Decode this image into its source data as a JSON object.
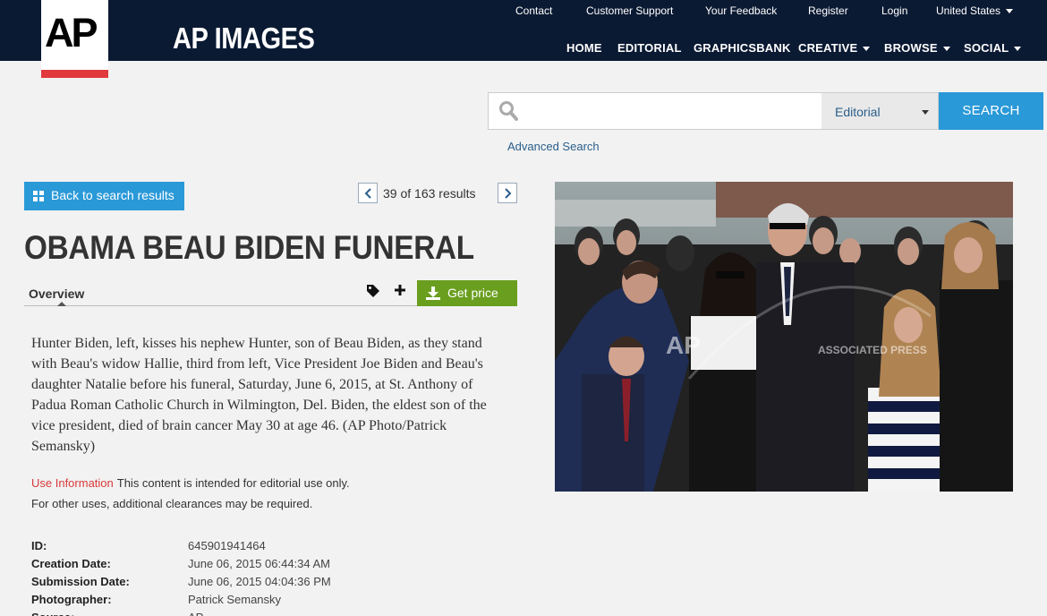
{
  "brand": {
    "logo_text": "AP",
    "name": "AP IMAGES"
  },
  "top_links": [
    "Contact",
    "Customer Support",
    "Your Feedback",
    "Register",
    "Login",
    "United States"
  ],
  "main_nav": [
    "HOME",
    "EDITORIAL",
    "GRAPHICSBANK",
    "CREATIVE",
    "BROWSE",
    "SOCIAL"
  ],
  "search": {
    "value": "",
    "placeholder": "",
    "scope": "Editorial",
    "button": "SEARCH",
    "advanced": "Advanced Search"
  },
  "back_button": "Back to search results",
  "pager": {
    "text": "39  of  163 results"
  },
  "title": "OBAMA BEAU BIDEN FUNERAL",
  "tabs": {
    "overview": "Overview"
  },
  "get_price": "Get price",
  "caption": "Hunter Biden, left, kisses his nephew Hunter, son of Beau Biden, as they stand with Beau's widow Hallie, third from left, Vice President Joe Biden and Beau's daughter Natalie before his funeral, Saturday, June 6, 2015, at St. Anthony of Padua Roman Catholic Church in Wilmington, Del. Biden, the eldest son of the vice president, died of brain cancer May 30 at age 46. (AP Photo/Patrick Semansky)",
  "use_info": {
    "label": "Use Information",
    "text": "This content is intended for editorial use only.",
    "other": "For other uses, additional clearances may be required."
  },
  "metadata": [
    {
      "key": "ID:",
      "value": "645901941464"
    },
    {
      "key": "Creation Date:",
      "value": "June 06, 2015 06:44:34 AM"
    },
    {
      "key": "Submission Date:",
      "value": "June 06, 2015 04:04:36 PM"
    },
    {
      "key": "Photographer:",
      "value": "Patrick Semansky"
    },
    {
      "key": "Source:",
      "value": "AP"
    }
  ],
  "photo": {
    "watermark_logo": "AP",
    "watermark_text": "ASSOCIATED PRESS"
  },
  "colors": {
    "header_bg": "#0b1a33",
    "accent_blue": "#2a99d8",
    "price_green": "#6a9e1f",
    "logo_red": "#e03a3e",
    "use_info_red": "#d9383a"
  },
  "icons": [
    "search-icon",
    "grid-icon",
    "chevron-left-icon",
    "chevron-right-icon",
    "tag-icon",
    "plus-icon",
    "download-icon",
    "caret-down-icon"
  ]
}
